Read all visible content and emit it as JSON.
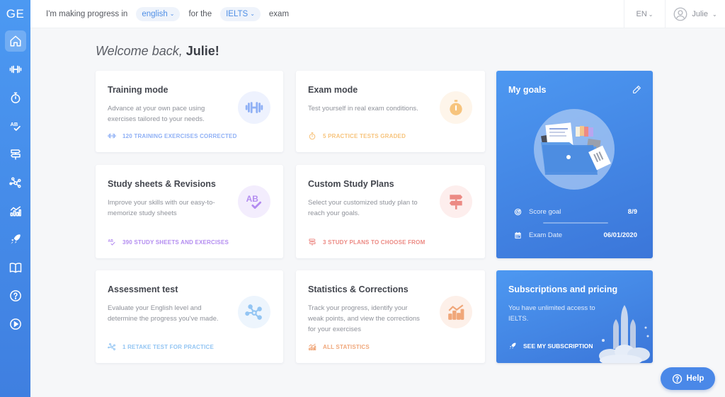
{
  "app": {
    "logo": "GE"
  },
  "sidebar": {
    "items": [
      {
        "name": "home",
        "active": true
      },
      {
        "name": "training"
      },
      {
        "name": "exam"
      },
      {
        "name": "study-sheets"
      },
      {
        "name": "study-plans"
      },
      {
        "name": "assessment"
      },
      {
        "name": "statistics"
      },
      {
        "name": "subscription"
      },
      {
        "name": "library"
      },
      {
        "name": "help"
      },
      {
        "name": "tutorial"
      }
    ]
  },
  "topbar": {
    "prefix": "I'm making progress in",
    "language_select": "english",
    "middle": "for the",
    "exam_select": "IELTS",
    "suffix": "exam",
    "ui_language": "EN",
    "user_name": "Julie"
  },
  "welcome": {
    "greeting": "Welcome back,",
    "name": "Julie!"
  },
  "cards": [
    {
      "title": "Training mode",
      "desc": "Advance at your own pace using exercises tailored to your needs.",
      "footer": "120 TRAINING EXERCISES CORRECTED",
      "color": "#8fb0f5",
      "bg": "#eef2fe"
    },
    {
      "title": "Exam mode",
      "desc": "Test yourself in real exam conditions.",
      "footer": "5 PRACTICE TESTS GRADED",
      "color": "#f7c47d",
      "bg": "#fef5ea"
    },
    {
      "title": "Study sheets & Revisions",
      "desc": "Improve your skills with our easy-to-memorize study sheets",
      "footer": "390 STUDY SHEETS AND EXERCISES",
      "color": "#b38cf0",
      "bg": "#f3edfd"
    },
    {
      "title": "Custom Study Plans",
      "desc": "Select your customized study plan to reach your goals.",
      "footer": "3 STUDY PLANS TO CHOOSE FROM",
      "color": "#ec8a84",
      "bg": "#fdeeed"
    },
    {
      "title": "Assessment test",
      "desc": "Evaluate your English level and determine the progress you've made.",
      "footer": "1 RETAKE TEST FOR PRACTICE",
      "color": "#93c5f3",
      "bg": "#edf5fd"
    },
    {
      "title": "Statistics & Corrections",
      "desc": "Track your progress, identify your weak points, and view the corrections for your exercises",
      "footer": "ALL STATISTICS",
      "color": "#f0a77a",
      "bg": "#fdf0e9"
    }
  ],
  "goals": {
    "title": "My goals",
    "score_label": "Score goal",
    "score_value": "8/9",
    "date_label": "Exam Date",
    "date_value": "06/01/2020"
  },
  "subscription": {
    "title": "Subscriptions and pricing",
    "desc": "You have unlimited access to IELTS.",
    "link": "SEE MY SUBSCRIPTION"
  },
  "help": {
    "label": "Help"
  },
  "colors": {
    "primary": "#4a88e8",
    "sidebar_top": "#4c99f2",
    "sidebar_bottom": "#3f7fe0"
  }
}
